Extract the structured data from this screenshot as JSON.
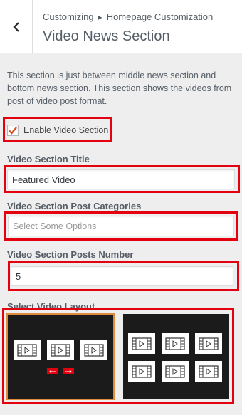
{
  "header": {
    "breadcrumb_root": "Customizing",
    "breadcrumb_parent": "Homepage Customization",
    "title": "Video News Section"
  },
  "section": {
    "description": "This section is just between middle news section and bottom news section. This section shows the videos from post of video post format.",
    "enable_label": "Enable Video Section",
    "enable_checked": true,
    "title_label": "Video Section Title",
    "title_value": "Featured Video",
    "categories_label": "Video Section Post Categories",
    "categories_placeholder": "Select Some Options",
    "posts_number_label": "Video Section Posts Number",
    "posts_number_value": "5",
    "layout_label": "Select Video Layout"
  },
  "layouts": [
    {
      "name": "layout-1",
      "rows": 1,
      "per_row": 3,
      "has_arrows": true,
      "selected": true
    },
    {
      "name": "layout-2",
      "rows": 2,
      "per_row": 3,
      "has_arrows": false,
      "selected": false
    }
  ],
  "colors": {
    "accent_red": "#e3000f",
    "check_orange": "#d54e21",
    "selected_outline": "#e08a3c"
  }
}
